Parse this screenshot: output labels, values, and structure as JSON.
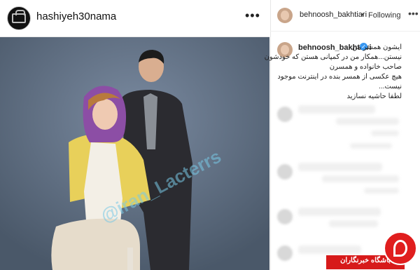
{
  "post": {
    "username": "hashiyeh30nama",
    "more_icon": "more-horizontal-icon",
    "photo_watermark": "@iran_Lacterrs"
  },
  "comments": {
    "header_username": "behnoosh_bakhtiari",
    "separator": "•",
    "follow_status": "Following",
    "more_icon": "more-horizontal-icon",
    "caption": {
      "username": "behnoosh_bakhtiari",
      "verified": "✓",
      "lines": [
        "ایشون همسر من",
        "نیستن...همکار من در کمپانی هستن که خودشون",
        "صاحب خانواده و همسرن",
        "هیچ عکسی از همسر بنده در اینترنت موجود",
        "نیست...",
        "لطفا حاشیه نسازید"
      ]
    }
  },
  "badge": {
    "label": "باشگاه خبرنگاران"
  },
  "colors": {
    "photo_bg": "#55657a",
    "badge_red": "#d71a1a",
    "verified_blue": "#3897f0"
  }
}
